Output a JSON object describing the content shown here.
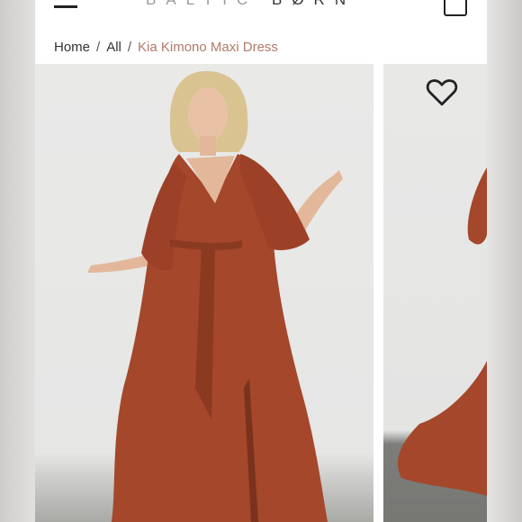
{
  "header": {
    "logo_left": "BALTIC",
    "logo_right": "BØRN",
    "menu_icon": "hamburger-menu-icon",
    "bag_icon": "shopping-bag-icon"
  },
  "breadcrumb": {
    "home": "Home",
    "all": "All",
    "separator": "/",
    "current": "Kia Kimono Maxi Dress"
  },
  "gallery": {
    "wishlist_icon": "heart-icon",
    "dress_color": "#a4472b",
    "accent_color": "#b07a6a"
  }
}
